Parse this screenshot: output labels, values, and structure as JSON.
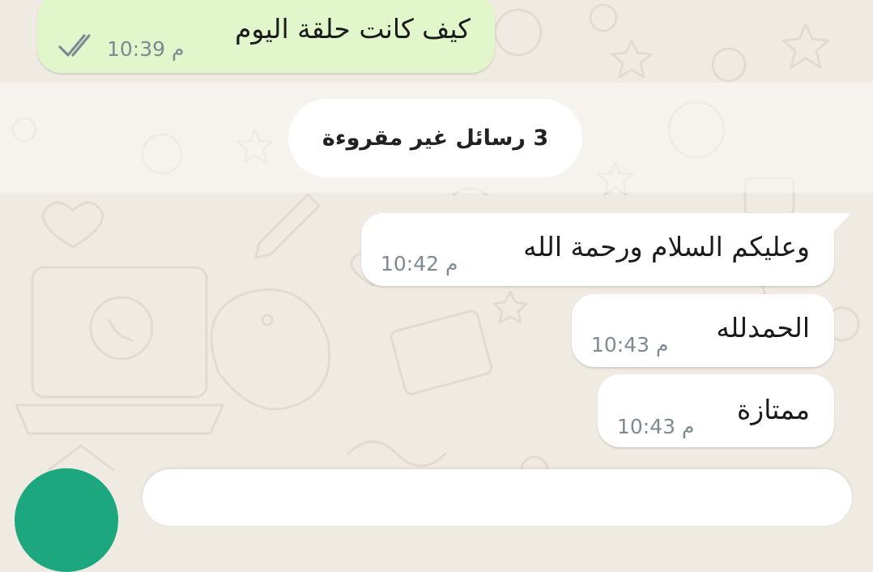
{
  "conversation": {
    "messages": [
      {
        "direction": "out",
        "text": "كيف كانت حلقة اليوم",
        "time": "10:39 م",
        "status_icon": "double-check-icon"
      },
      {
        "direction": "in",
        "text": "وعليكم السلام ورحمة الله",
        "time": "10:42 م"
      },
      {
        "direction": "in",
        "text": "الحمدلله",
        "time": "10:43 م"
      },
      {
        "direction": "in",
        "text": "ممتازة",
        "time": "10:43 م"
      }
    ],
    "unread_divider": "3 رسائل غير مقروءة"
  },
  "composer": {
    "fab_icon": "mic-icon"
  },
  "colors": {
    "background": "#efeae2",
    "outgoing_bubble": "#e1f7cb",
    "incoming_bubble": "#ffffff",
    "fab": "#1da77e",
    "timestamp": "#7d8a91"
  }
}
